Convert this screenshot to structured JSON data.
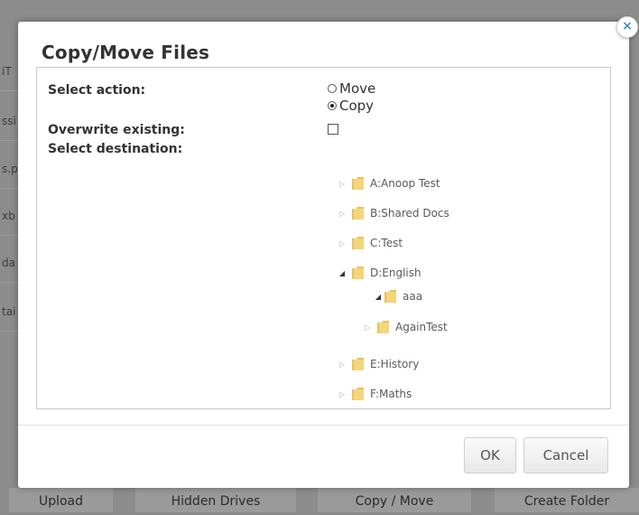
{
  "background": {
    "fragments": [
      "iT",
      "ssi",
      "s.p",
      "xb",
      "da",
      "tai"
    ],
    "bottom_bar": {
      "upload": "Upload",
      "hidden_drives": "Hidden Drives",
      "copy_move": "Copy / Move",
      "create_folder": "Create Folder"
    }
  },
  "dialog": {
    "title": "Copy/Move Files",
    "close_icon": "×",
    "select_action_label": "Select action:",
    "options": {
      "move": "Move",
      "copy": "Copy"
    },
    "selected_option": "copy",
    "overwrite_label": "Overwrite existing:",
    "overwrite_checked": false,
    "destination_label": "Select destination:",
    "tree": {
      "a": "A:Anoop Test",
      "b": "B:Shared Docs",
      "c": "C:Test",
      "d": "D:English",
      "d_aaa": "aaa",
      "d_aaa_again": "AgainTest",
      "e": "E:History",
      "f": "F:Maths"
    },
    "ok_label": "OK",
    "cancel_label": "Cancel"
  },
  "colors": {
    "folder": "#e8c35a",
    "accent": "#3b8fd9"
  },
  "icons": {
    "folder": "folder-icon",
    "collapsed": "triangle-right-icon",
    "expanded": "triangle-down-icon",
    "close": "close-icon"
  }
}
